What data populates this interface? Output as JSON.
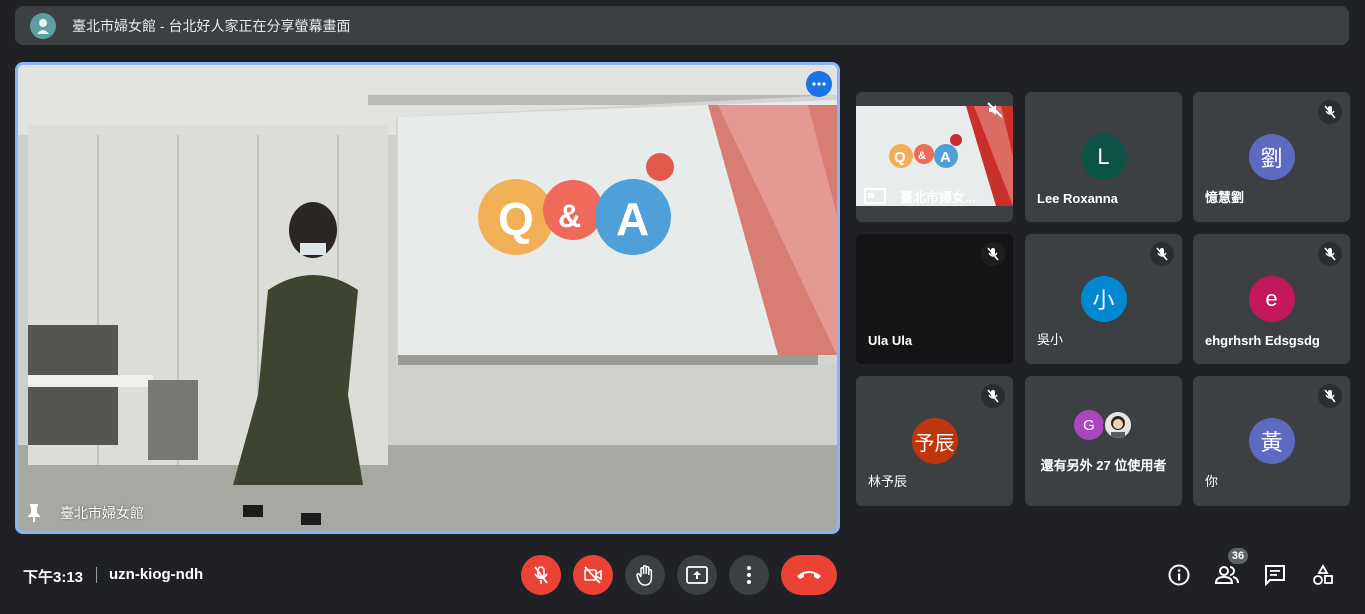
{
  "header": {
    "title": "臺北市婦女館 - 台北好人家正在分享螢幕畫面"
  },
  "main_stage": {
    "presenter_label": "臺北市婦女館",
    "slide_text": "Q&A"
  },
  "tiles": [
    {
      "name": "臺北市婦女...",
      "type": "screen-share"
    },
    {
      "name": "Lee Roxanna",
      "initial": "L",
      "color": "#0b5345"
    },
    {
      "name": "憶慧劉",
      "initial": "劉",
      "color": "#5c6bc0"
    },
    {
      "name": "Ula Ula",
      "type": "video"
    },
    {
      "name": "吳小",
      "initial": "小",
      "color": "#0288d1"
    },
    {
      "name": "ehgrhsrh Edsgsdg",
      "initial": "e",
      "color": "#c2185b"
    },
    {
      "name": "林予辰",
      "initial": "予辰",
      "color": "#bf360c"
    },
    {
      "name": "還有另外 27 位使用者",
      "initial": "G",
      "color": "#ab47bc"
    },
    {
      "name": "你",
      "initial": "黃",
      "color": "#5c6bc0"
    }
  ],
  "footer": {
    "time": "下午3:13",
    "meeting_code": "uzn-kiog-ndh",
    "participants_count": "36"
  }
}
